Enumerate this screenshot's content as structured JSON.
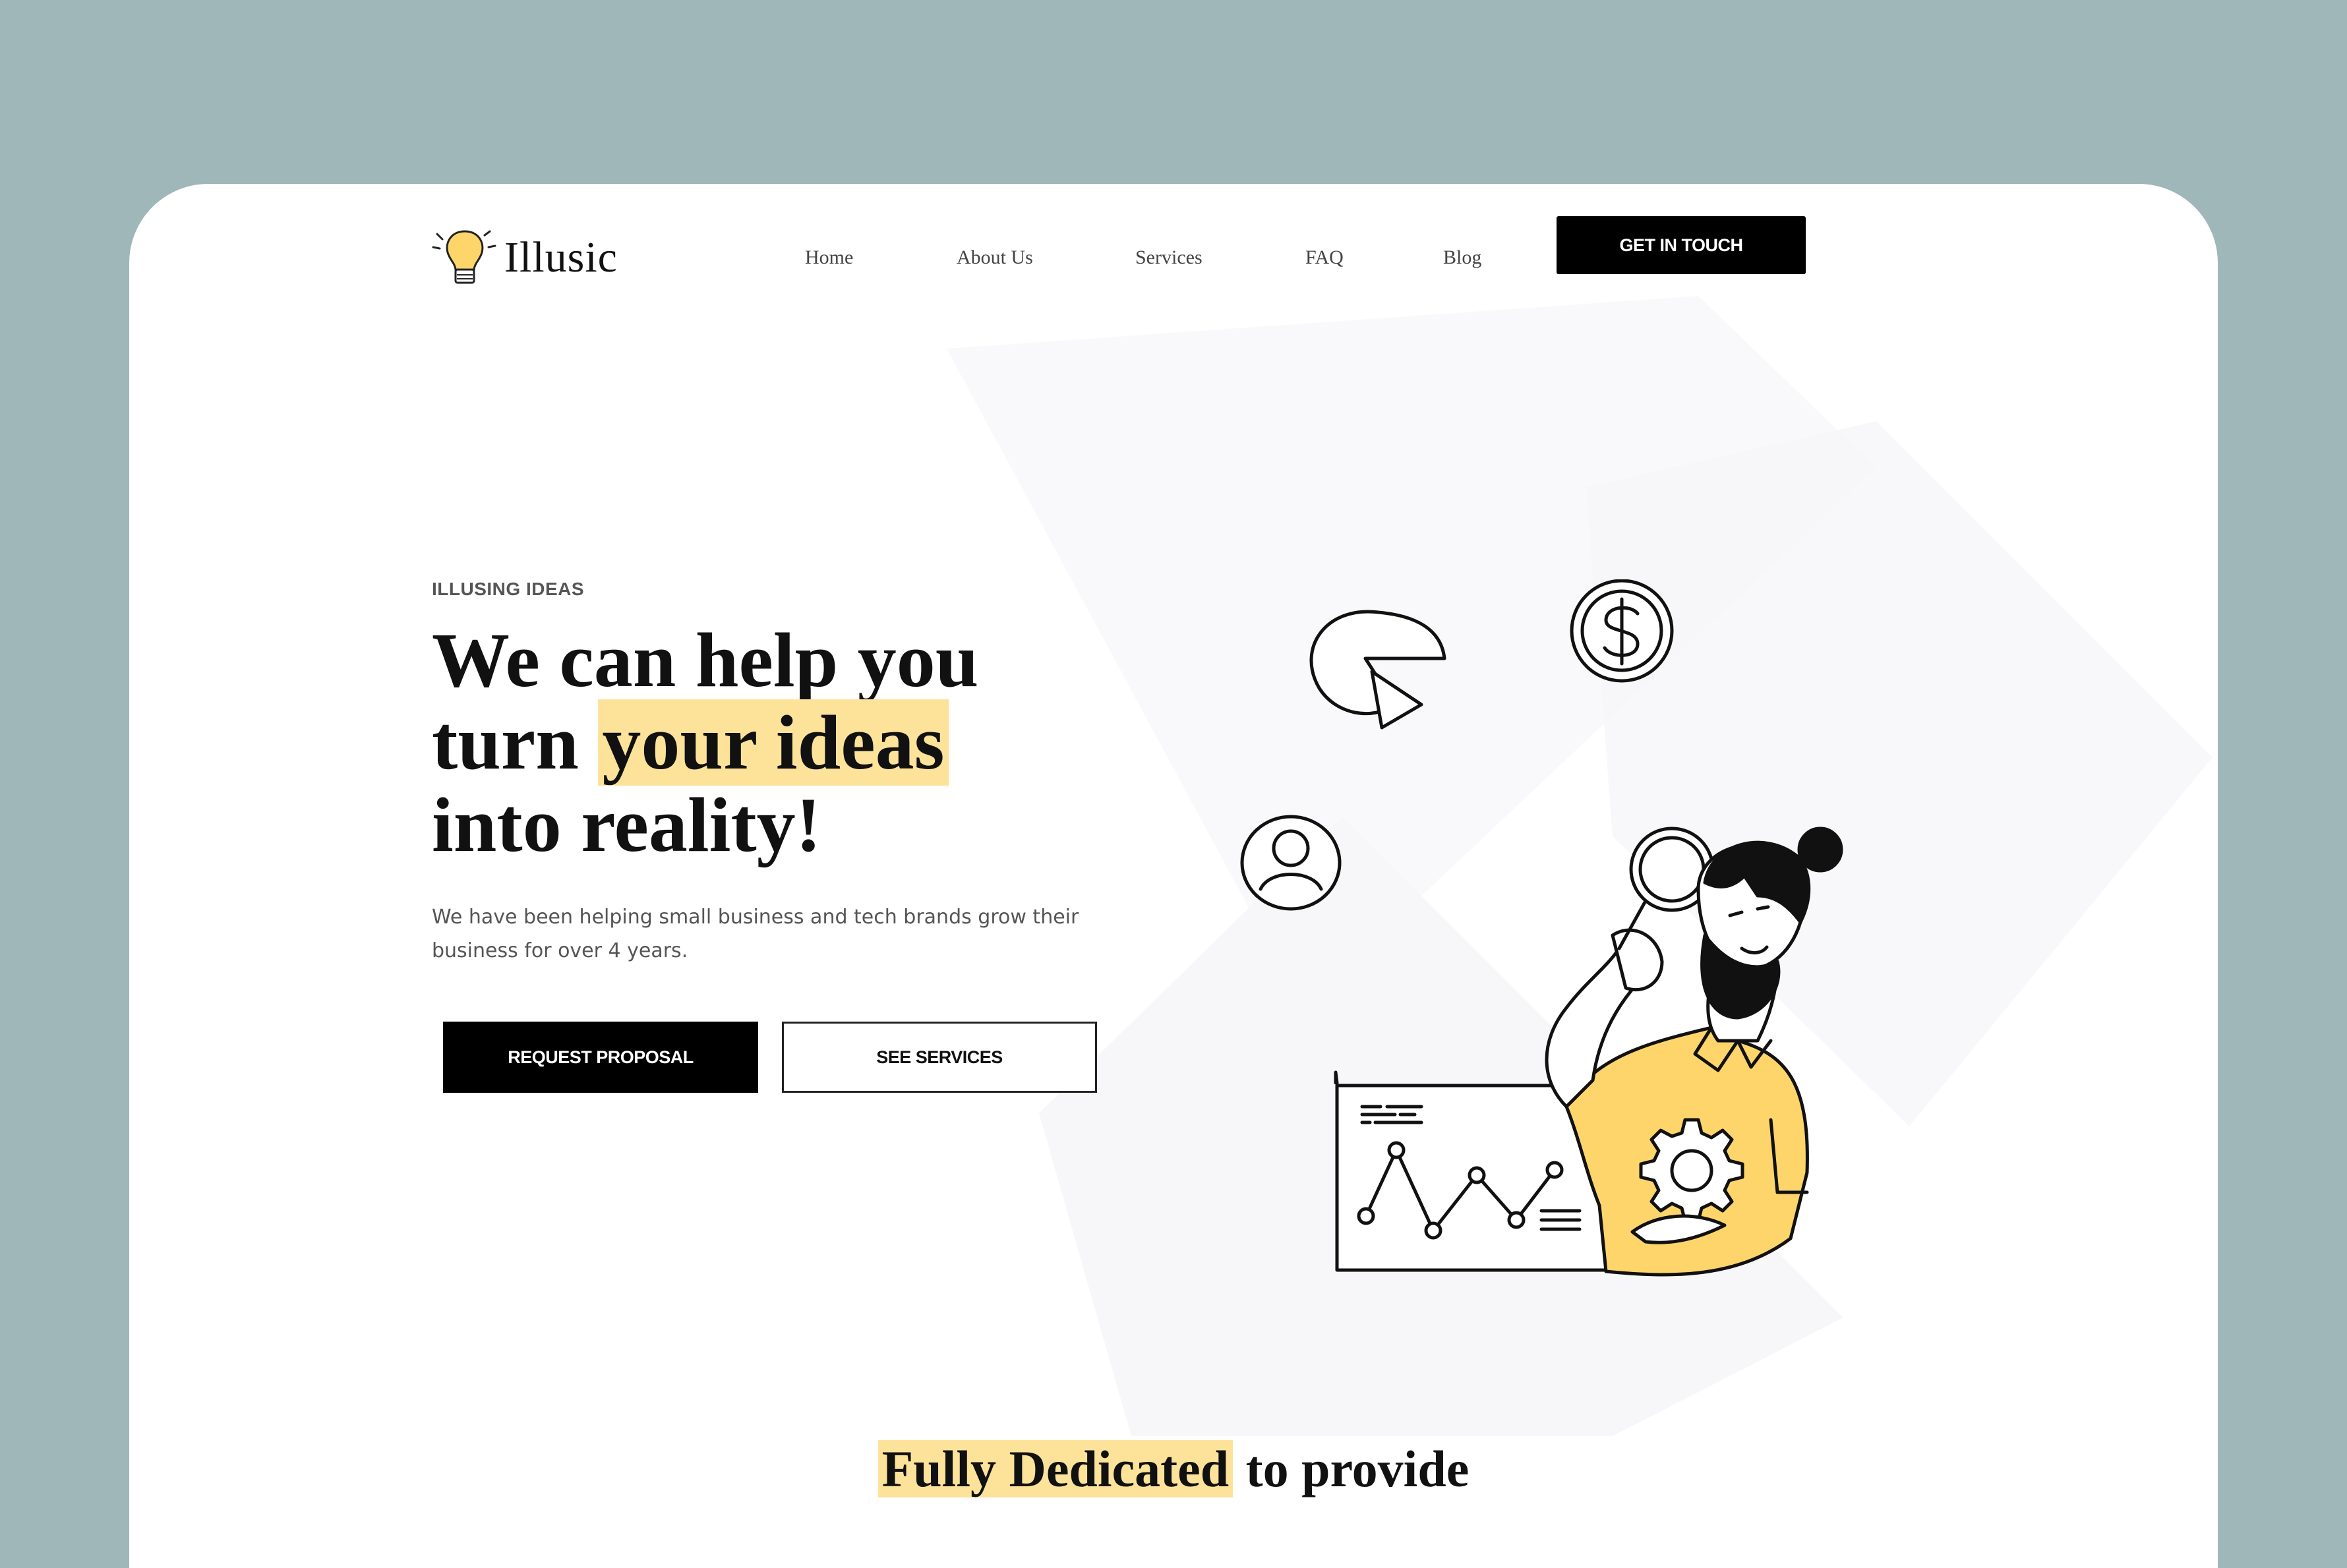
{
  "brand": {
    "name": "Illusic",
    "logo_icon": "lightbulb-icon",
    "accent": "#fdd56b",
    "highlight": "#fde39a"
  },
  "nav": {
    "items": [
      {
        "label": "Home"
      },
      {
        "label": "About Us"
      },
      {
        "label": "Services"
      },
      {
        "label": "FAQ"
      },
      {
        "label": "Blog"
      }
    ],
    "cta_label": "GET IN TOUCH"
  },
  "hero": {
    "eyebrow": "ILLUSING IDEAS",
    "headline_1": "We can help you",
    "headline_2a": "turn ",
    "headline_2_highlight": "your ideas",
    "headline_3": "into reality!",
    "description": "We have been helping small business and tech brands grow their business for over 4 years.",
    "primary_button": "REQUEST PROPOSAL",
    "secondary_button": "SEE SERVICES",
    "illustration_icons": [
      "pie-chart-icon",
      "dollar-coin-icon",
      "user-avatar-icon",
      "magnifier-icon",
      "gear-icon",
      "line-chart-icon"
    ]
  },
  "section": {
    "title_highlight": "Fully Dedicated",
    "title_rest": " to provide"
  },
  "colors": {
    "page_bg": "#9fb7b9",
    "card_bg": "#ffffff",
    "text": "#111111"
  }
}
